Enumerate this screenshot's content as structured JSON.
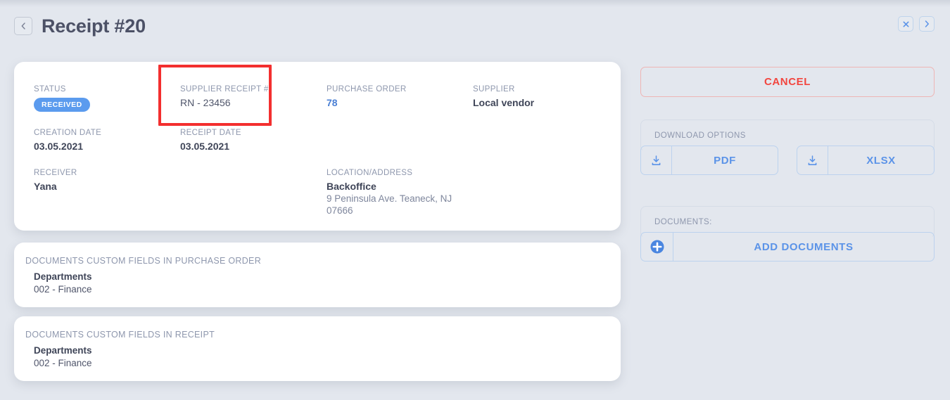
{
  "header": {
    "title": "Receipt #20",
    "back_icon": "chevron-left-icon",
    "close_icon": "close-icon",
    "next_icon": "chevron-right-icon"
  },
  "receipt": {
    "status": {
      "label": "STATUS",
      "value": "RECEIVED",
      "color": "#5b9bee"
    },
    "supplier_receipt_no": {
      "label": "SUPPLIER RECEIPT #",
      "value": "RN - 23456"
    },
    "purchase_order": {
      "label": "PURCHASE ORDER",
      "value": "78",
      "color": "#4a7fd4"
    },
    "supplier": {
      "label": "SUPPLIER",
      "value": "Local vendor"
    },
    "creation_date": {
      "label": "CREATION DATE",
      "value": "03.05.2021"
    },
    "receipt_date": {
      "label": "RECEIPT DATE",
      "value": "03.05.2021"
    },
    "receiver": {
      "label": "RECEIVER",
      "value": "Yana"
    },
    "location": {
      "label": "LOCATION/ADDRESS",
      "name": "Backoffice",
      "address_line1": "9 Peninsula Ave. Teaneck, NJ",
      "address_line2": "07666"
    }
  },
  "custom_fields": [
    {
      "title": "DOCUMENTS CUSTOM FIELDS IN PURCHASE ORDER",
      "field_name": "Departments",
      "field_value": "002 - Finance"
    },
    {
      "title": "DOCUMENTS CUSTOM FIELDS IN RECEIPT",
      "field_name": "Departments",
      "field_value": "002 - Finance"
    }
  ],
  "actions": {
    "cancel_label": "CANCEL",
    "cancel_color": "#f2463f",
    "download_group_label": "DOWNLOAD OPTIONS",
    "pdf_label": "PDF",
    "xlsx_label": "XLSX",
    "download_icon": "download-icon",
    "documents_group_label": "DOCUMENTS:",
    "add_documents_label": "ADD DOCUMENTS",
    "add_icon": "plus-circle-icon",
    "accent_color": "#5b93e8"
  },
  "annotation": {
    "highlight_color": "#f32f2f",
    "highlight_target": "supplier-receipt-number-field"
  }
}
